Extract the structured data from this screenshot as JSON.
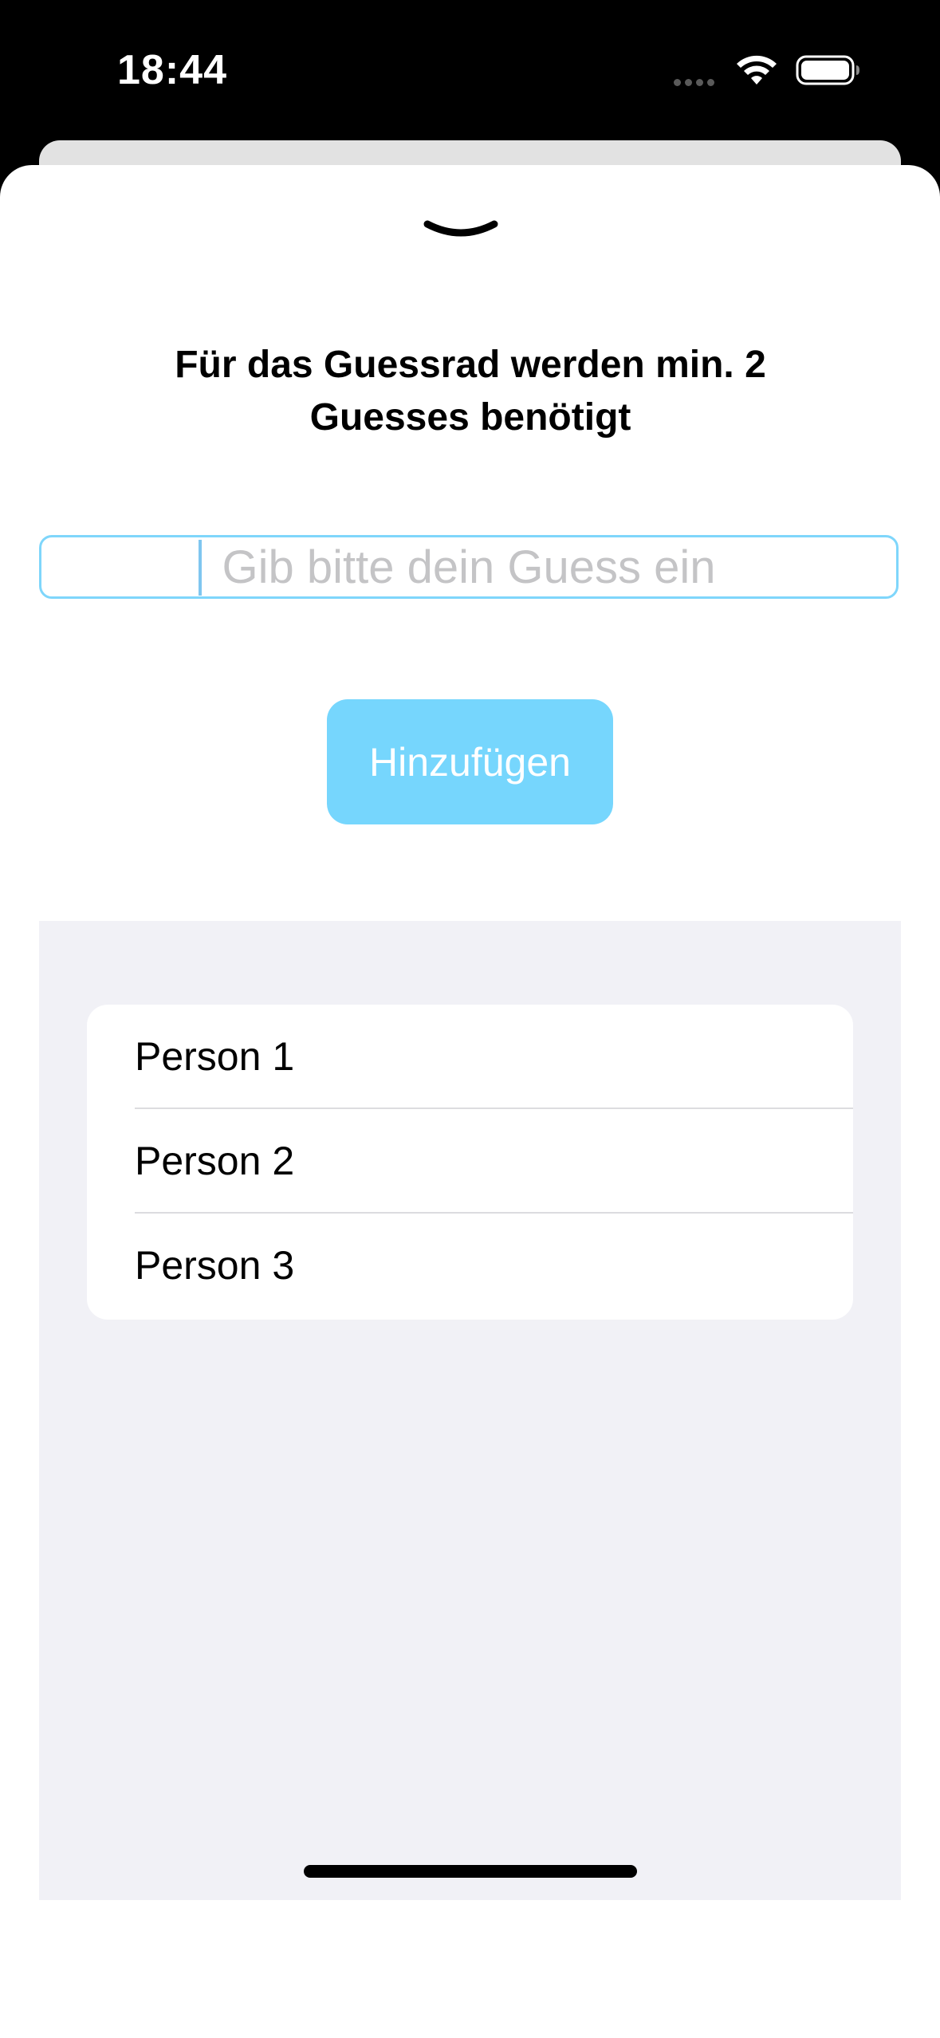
{
  "status_bar": {
    "time": "18:44"
  },
  "sheet": {
    "dismiss_icon": "chevron-down-icon",
    "title_line1": "Für das Guessrad werden min. 2",
    "title_line2": "Guesses benötigt",
    "input": {
      "value": "",
      "placeholder": "Gib bitte dein Guess ein"
    },
    "add_button_label": "Hinzufügen",
    "list_items": [
      {
        "label": "Person 1"
      },
      {
        "label": "Person 2"
      },
      {
        "label": "Person 3"
      }
    ]
  },
  "colors": {
    "accent": "#76d6fd",
    "input_border": "#7fd6fb",
    "list_background": "#f1f1f6"
  }
}
